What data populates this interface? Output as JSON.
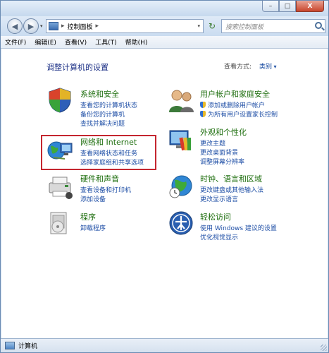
{
  "window": {
    "min_label": "–",
    "max_label": "□",
    "close_label": "X"
  },
  "nav": {
    "back_glyph": "◀",
    "forward_glyph": "▶",
    "address_sep": "▸",
    "address_text": "控制面板",
    "address_sep2": "▸",
    "refresh_glyph": "↻",
    "search_placeholder": "搜索控制面板"
  },
  "menu": [
    {
      "label": "文件(F)"
    },
    {
      "label": "编辑(E)"
    },
    {
      "label": "查看(V)"
    },
    {
      "label": "工具(T)"
    },
    {
      "label": "帮助(H)"
    }
  ],
  "main": {
    "heading": "调整计算机的设置",
    "view_by_label": "查看方式:",
    "view_by_value": "类别"
  },
  "categories": {
    "system": {
      "title": "系统和安全",
      "links": [
        "查看您的计算机状态",
        "备份您的计算机",
        "查找并解决问题"
      ]
    },
    "network": {
      "title": "网络和 Internet",
      "links": [
        "查看网络状态和任务",
        "选择家庭组和共享选项"
      ]
    },
    "hardware": {
      "title": "硬件和声音",
      "links": [
        "查看设备和打印机",
        "添加设备"
      ]
    },
    "programs": {
      "title": "程序",
      "links": [
        "卸载程序"
      ]
    },
    "users": {
      "title": "用户帐户和家庭安全",
      "links": [
        "添加或删除用户帐户",
        "为所有用户设置家长控制"
      ]
    },
    "appearance": {
      "title": "外观和个性化",
      "links": [
        "更改主题",
        "更改桌面背景",
        "调整屏幕分辨率"
      ]
    },
    "clock": {
      "title": "时钟、语言和区域",
      "links": [
        "更改键盘或其他输入法",
        "更改显示语言"
      ]
    },
    "ease": {
      "title": "轻松访问",
      "links": [
        "使用 Windows 建议的设置",
        "优化视觉显示"
      ]
    }
  },
  "status": {
    "text": "计算机"
  },
  "colors": {
    "heading": "#1e3287",
    "category_title": "#1e6e0e",
    "link": "#1f4fa6",
    "highlight_box": "#c4262f"
  }
}
